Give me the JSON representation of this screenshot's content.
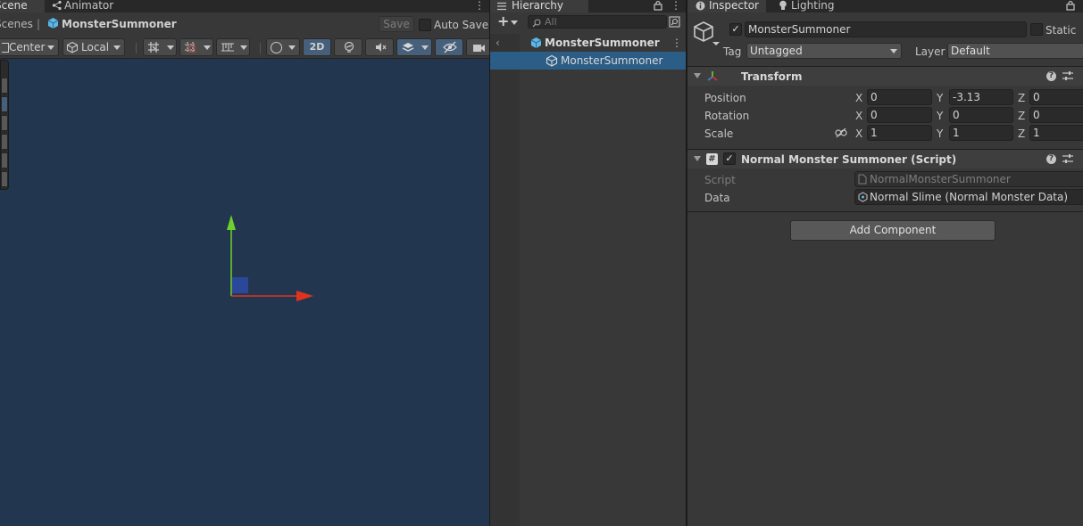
{
  "scene": {
    "tabs": [
      {
        "label": "Scene"
      },
      {
        "label": "Animator"
      }
    ],
    "breadcrumb": {
      "root": "Scenes",
      "separator": "|",
      "current": "MonsterSummoner"
    },
    "save_label": "Save",
    "auto_save_label": "Auto Save",
    "auto_save_checked": false,
    "toolbar": {
      "pivot_label": "Center",
      "space_label": "Local",
      "mode_2d_label": "2D",
      "mode_2d_active": true
    }
  },
  "hierarchy": {
    "tab_label": "Hierarchy",
    "add_symbol": "+",
    "search_placeholder": "All",
    "scene_name": "MonsterSummoner",
    "items": [
      {
        "label": "MonsterSummoner",
        "selected": true
      }
    ]
  },
  "inspector": {
    "tabs": [
      {
        "label": "Inspector"
      },
      {
        "label": "Lighting"
      }
    ],
    "object_active": true,
    "object_name": "MonsterSummoner",
    "static_label": "Static",
    "static_checked": false,
    "tag_label": "Tag",
    "tag_value": "Untagged",
    "layer_label": "Layer",
    "layer_value": "Default",
    "transform": {
      "title": "Transform",
      "position": {
        "label": "Position",
        "x": "0",
        "y": "-3.13",
        "z": "0"
      },
      "rotation": {
        "label": "Rotation",
        "x": "0",
        "y": "0",
        "z": "0"
      },
      "scale": {
        "label": "Scale",
        "x": "1",
        "y": "1",
        "z": "1"
      },
      "axis_labels": {
        "x": "X",
        "y": "Y",
        "z": "Z"
      }
    },
    "script_component": {
      "enabled": true,
      "title": "Normal Monster Summoner (Script)",
      "script_label": "Script",
      "script_value": "NormalMonsterSummoner",
      "data_label": "Data",
      "data_value": "Normal Slime (Normal Monster Data)"
    },
    "add_component_label": "Add Component",
    "help_symbol": "?"
  },
  "colors": {
    "scene_background": "#22374f",
    "selection": "#2c5d87",
    "axis_x": "#e0331f",
    "axis_y": "#6ed12b",
    "axis_z": "#2c4aa6"
  }
}
